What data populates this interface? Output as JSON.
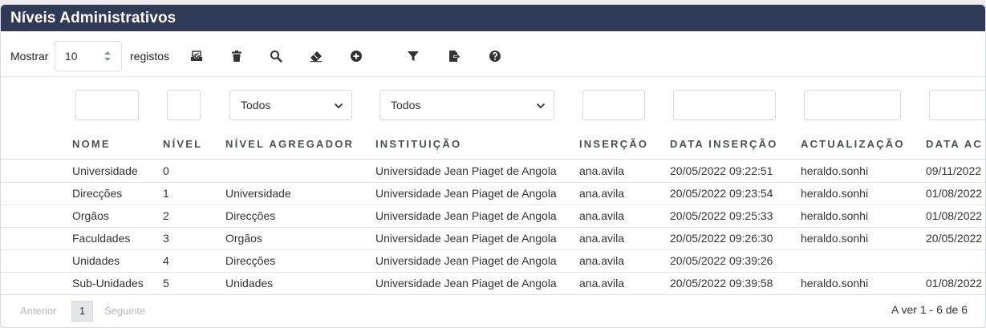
{
  "title": "Níveis Administrativos",
  "toolbar": {
    "show_label": "Mostrar",
    "page_size": "10",
    "records_label": "registos",
    "icons": [
      "inbox-check-icon",
      "trash-icon",
      "search-icon",
      "eraser-icon",
      "add-circle-icon",
      "filter-icon",
      "export-icon",
      "help-icon"
    ]
  },
  "filters": {
    "nivel_agregador": "Todos",
    "instituicao": "Todos"
  },
  "columns": [
    "NOME",
    "NÍVEL",
    "NÍVEL AGREGADOR",
    "INSTITUIÇÃO",
    "INSERÇÃO",
    "DATA INSERÇÃO",
    "ACTUALIZAÇÃO",
    "DATA AC"
  ],
  "rows": [
    [
      "Universidade",
      "0",
      "",
      "Universidade Jean Piaget de Angola",
      "ana.avila",
      "20/05/2022 09:22:51",
      "heraldo.sonhi",
      "09/11/2022"
    ],
    [
      "Direcções",
      "1",
      "Universidade",
      "Universidade Jean Piaget de Angola",
      "ana.avila",
      "20/05/2022 09:23:54",
      "heraldo.sonhi",
      "01/08/2022"
    ],
    [
      "Orgãos",
      "2",
      "Direcções",
      "Universidade Jean Piaget de Angola",
      "ana.avila",
      "20/05/2022 09:25:33",
      "heraldo.sonhi",
      "01/08/2022"
    ],
    [
      "Faculdades",
      "3",
      "Orgãos",
      "Universidade Jean Piaget de Angola",
      "ana.avila",
      "20/05/2022 09:26:30",
      "heraldo.sonhi",
      "20/05/2022"
    ],
    [
      "Unidades",
      "4",
      "Direcções",
      "Universidade Jean Piaget de Angola",
      "ana.avila",
      "20/05/2022 09:39:26",
      "",
      ""
    ],
    [
      "Sub-Unidades",
      "5",
      "Unidades",
      "Universidade Jean Piaget de Angola",
      "ana.avila",
      "20/05/2022 09:39:58",
      "heraldo.sonhi",
      "01/08/2022"
    ]
  ],
  "pager": {
    "prev": "Anterior",
    "current": "1",
    "next": "Seguinte",
    "info": "A ver 1 - 6 de 6"
  }
}
